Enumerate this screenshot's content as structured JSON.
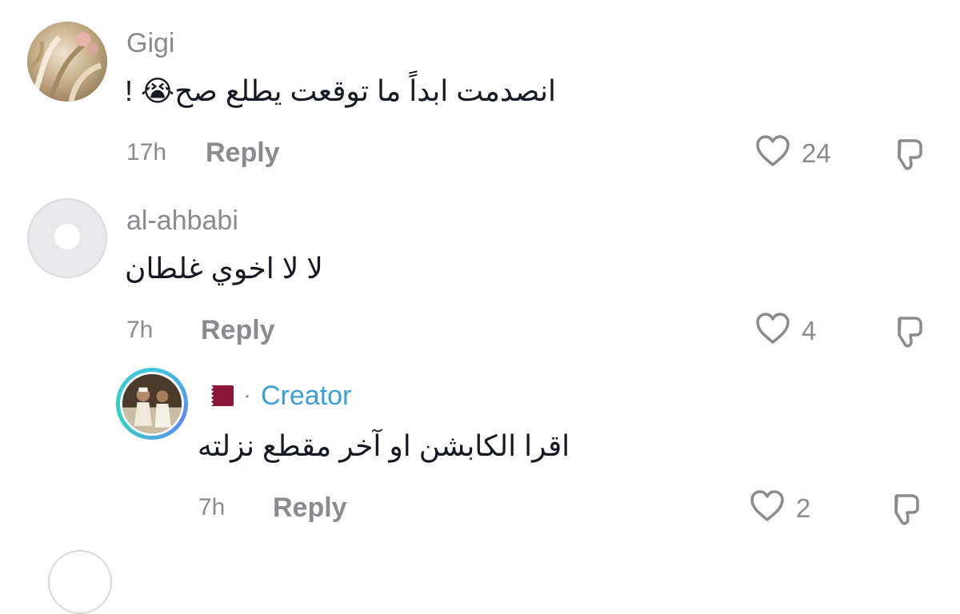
{
  "comments": [
    {
      "username": "Gigi",
      "text": "انصدمت ابداً ما توقعت يطلع صح😭 !",
      "time": "17h",
      "reply_label": "Reply",
      "likes": "24"
    },
    {
      "username": "al-ahbabi",
      "text": "لا لا اخوي غلطان",
      "time": "7h",
      "reply_label": "Reply",
      "likes": "4"
    }
  ],
  "reply": {
    "dot": "·",
    "badge": "Creator",
    "text": "اقرا الكابشن او آخر مقطع نزلته",
    "time": "7h",
    "reply_label": "Reply",
    "likes": "2"
  },
  "colors": {
    "muted": "#8a8a8f",
    "text": "#161823",
    "creator": "#3c9ed8",
    "flag_maroon": "#8a1538"
  },
  "icons": {
    "like": "heart-outline-icon",
    "dislike": "thumbs-down-outline-icon",
    "flag": "qatar-flag-icon"
  }
}
